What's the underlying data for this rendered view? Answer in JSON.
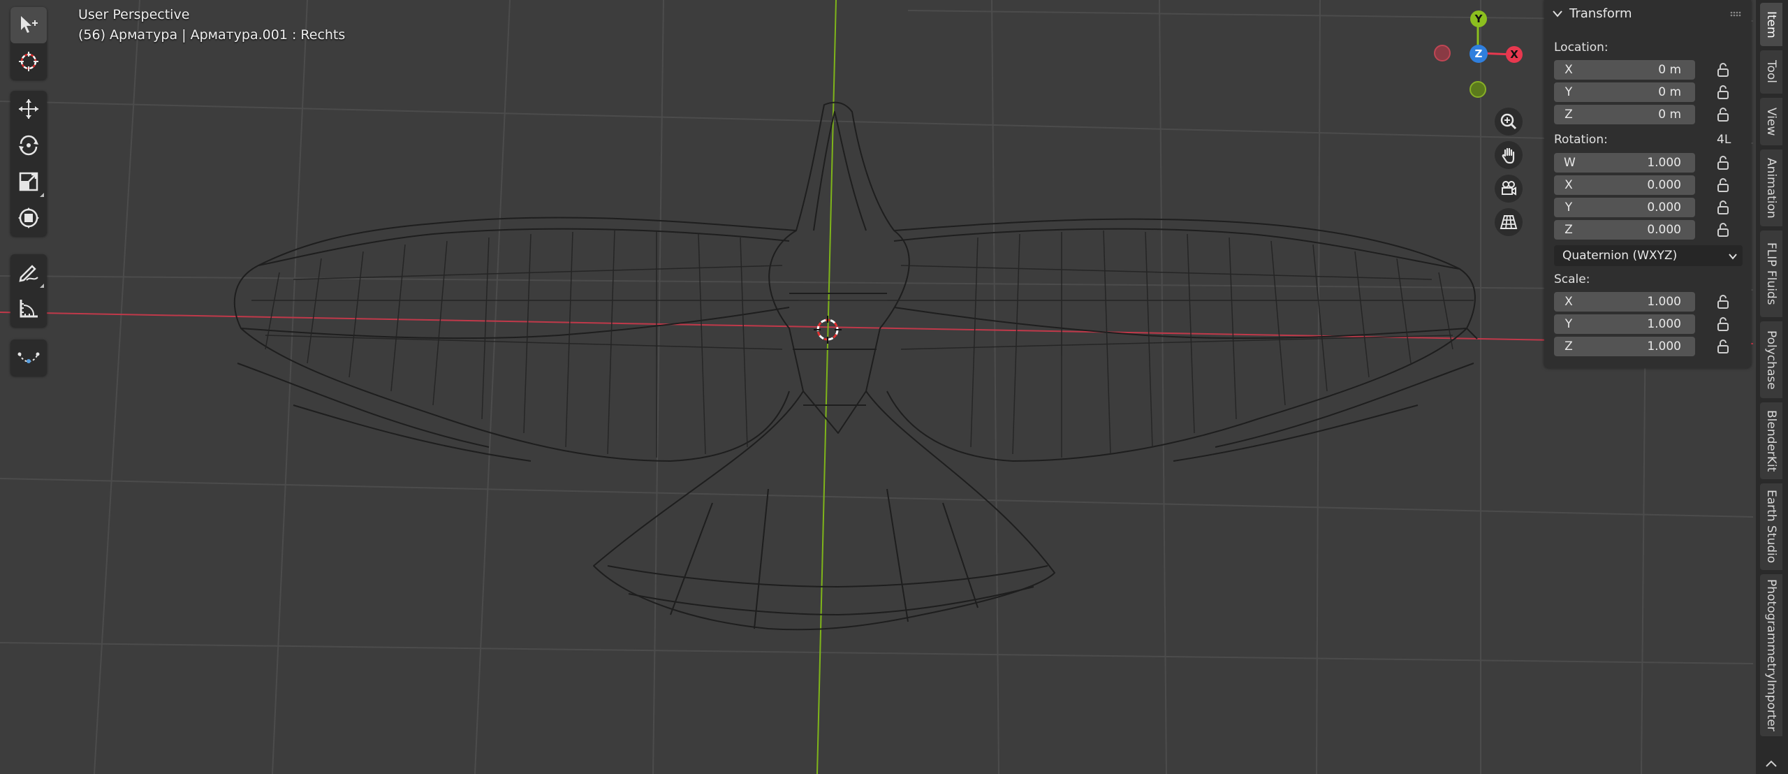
{
  "viewport": {
    "mode_label": "User Perspective",
    "context_label": "(56) Арматура | Арматура.001 : Rechts"
  },
  "toolbar": {
    "tools": [
      {
        "name": "select-box-tool",
        "icon": "cursor-select-icon"
      },
      {
        "name": "cursor-tool",
        "icon": "3d-cursor-icon"
      },
      {
        "name": "move-tool",
        "icon": "move-arrows-icon"
      },
      {
        "name": "rotate-tool",
        "icon": "rotate-icon"
      },
      {
        "name": "scale-tool",
        "icon": "scale-icon"
      },
      {
        "name": "transform-tool",
        "icon": "transform-icon"
      },
      {
        "name": "annotate-tool",
        "icon": "pencil-icon"
      },
      {
        "name": "measure-tool",
        "icon": "ruler-icon"
      },
      {
        "name": "bone-envelope-tool",
        "icon": "curve-icon"
      }
    ]
  },
  "gizmo": {
    "x_label": "X",
    "y_label": "Y",
    "z_label": "Z",
    "colors": {
      "x": "#e8384f",
      "y": "#8cbf1f",
      "z": "#2f7fde"
    }
  },
  "transform_panel": {
    "title": "Transform",
    "location_label": "Location:",
    "location": [
      {
        "axis": "X",
        "value": "0 m"
      },
      {
        "axis": "Y",
        "value": "0 m"
      },
      {
        "axis": "Z",
        "value": "0 m"
      }
    ],
    "rotation_label": "Rotation:",
    "rotation_lock_label": "4L",
    "rotation": [
      {
        "axis": "W",
        "value": "1.000"
      },
      {
        "axis": "X",
        "value": "0.000"
      },
      {
        "axis": "Y",
        "value": "0.000"
      },
      {
        "axis": "Z",
        "value": "0.000"
      }
    ],
    "rotation_mode": "Quaternion (WXYZ)",
    "scale_label": "Scale:",
    "scale": [
      {
        "axis": "X",
        "value": "1.000"
      },
      {
        "axis": "Y",
        "value": "1.000"
      },
      {
        "axis": "Z",
        "value": "1.000"
      }
    ]
  },
  "sidebar_tabs": [
    "Item",
    "Tool",
    "View",
    "Animation",
    "FLIP Fluids",
    "Polychase",
    "BlenderKit",
    "Earth Studio",
    "PhotogrammetryImporter"
  ],
  "colors": {
    "background": "#3d3d3d",
    "x_axis_line": "#c0394a",
    "y_axis_line": "#7fb51a",
    "panel": "#2f2f2f",
    "field": "#545454"
  }
}
